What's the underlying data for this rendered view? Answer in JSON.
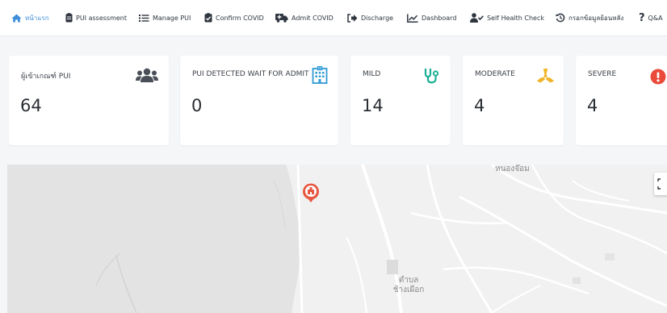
{
  "nav": {
    "items": [
      {
        "label": "หน้าแรก",
        "icon": "home-icon"
      },
      {
        "label": "PUI assessment",
        "icon": "clipboard-icon"
      },
      {
        "label": "Manage PUI",
        "icon": "list-icon"
      },
      {
        "label": "Confirm COVID",
        "icon": "clipboard-check-icon"
      },
      {
        "label": "Admit COVID",
        "icon": "ambulance-icon"
      },
      {
        "label": "Discharge",
        "icon": "sign-out-icon"
      },
      {
        "label": "Dashboard",
        "icon": "line-chart-icon"
      },
      {
        "label": "Self Health Check",
        "icon": "user-check-icon"
      },
      {
        "label": "กรอกข้อมูลย้อนหลัง",
        "icon": "history-icon"
      },
      {
        "label": "Q&A",
        "icon": "question-icon"
      }
    ],
    "active_index": 0
  },
  "cards": [
    {
      "title": "ผู้เข้าเกณฑ์ PUI",
      "value": "64",
      "icon": "users-icon",
      "icon_color": "#4a4f57"
    },
    {
      "title": "PUI DETECTED WAIT FOR ADMIT",
      "value": "0",
      "icon": "hospital-building-icon",
      "icon_color": "#2f9ad6"
    },
    {
      "title": "MILD",
      "value": "14",
      "icon": "stethoscope-icon",
      "icon_color": "#1aaf95"
    },
    {
      "title": "MODERATE",
      "value": "4",
      "icon": "radiation-icon",
      "icon_color": "#f0b429"
    },
    {
      "title": "SEVERE",
      "value": "4",
      "icon": "exclamation-circle-icon",
      "icon_color": "#ea4a3a"
    }
  ],
  "map": {
    "labels": {
      "place_top": "หนองจ๊อม",
      "subdistrict_line1": "ตำบล",
      "subdistrict_line2": "ช้างเผือก"
    },
    "marker_icon": "hospital-marker-icon",
    "marker_color": "#e8573f"
  }
}
